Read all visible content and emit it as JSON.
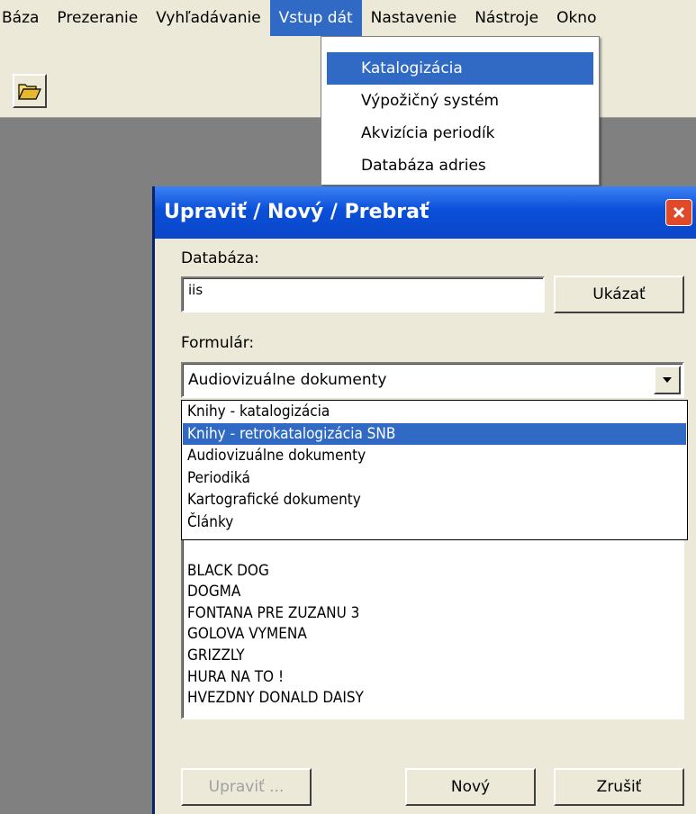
{
  "menubar": {
    "items": [
      "Báza",
      "Prezeranie",
      "Vyhľadávanie",
      "Vstup dát",
      "Nastavenie",
      "Nástroje",
      "Okno"
    ]
  },
  "toolbar": {
    "open_icon": "folder-open-icon"
  },
  "menu_vstup": {
    "items": [
      "Katalogizácia",
      "Výpožičný systém",
      "Akvizícia periodík",
      "Databáza adries"
    ]
  },
  "dialog": {
    "title": "Upraviť / Nový / Prebrať",
    "db_label": "Databáza:",
    "db_value": "iis",
    "show_button": "Ukázať",
    "form_label": "Formulár:",
    "form_selected": "Audiovizuálne dokumenty",
    "form_options": [
      "Knihy - katalogizácia",
      "Knihy - retrokatalogizácia SNB",
      "Audiovizuálne dokumenty",
      "Periodiká",
      "Kartografické dokumenty",
      "Články"
    ],
    "records": [
      "BLACK DOG",
      "DOGMA",
      "FONTANA PRE ZUZANU 3",
      "GOLOVA VYMENA",
      "GRIZZLY",
      "HURA NA TO !",
      "HVEZDNY DONALD DAISY"
    ],
    "edit_button": "Upraviť ...",
    "new_button": "Nový",
    "cancel_button": "Zrušiť"
  },
  "colors": {
    "highlight": "#316ac5",
    "titlebar": "#0a4fd8",
    "close": "#e04a2a"
  }
}
